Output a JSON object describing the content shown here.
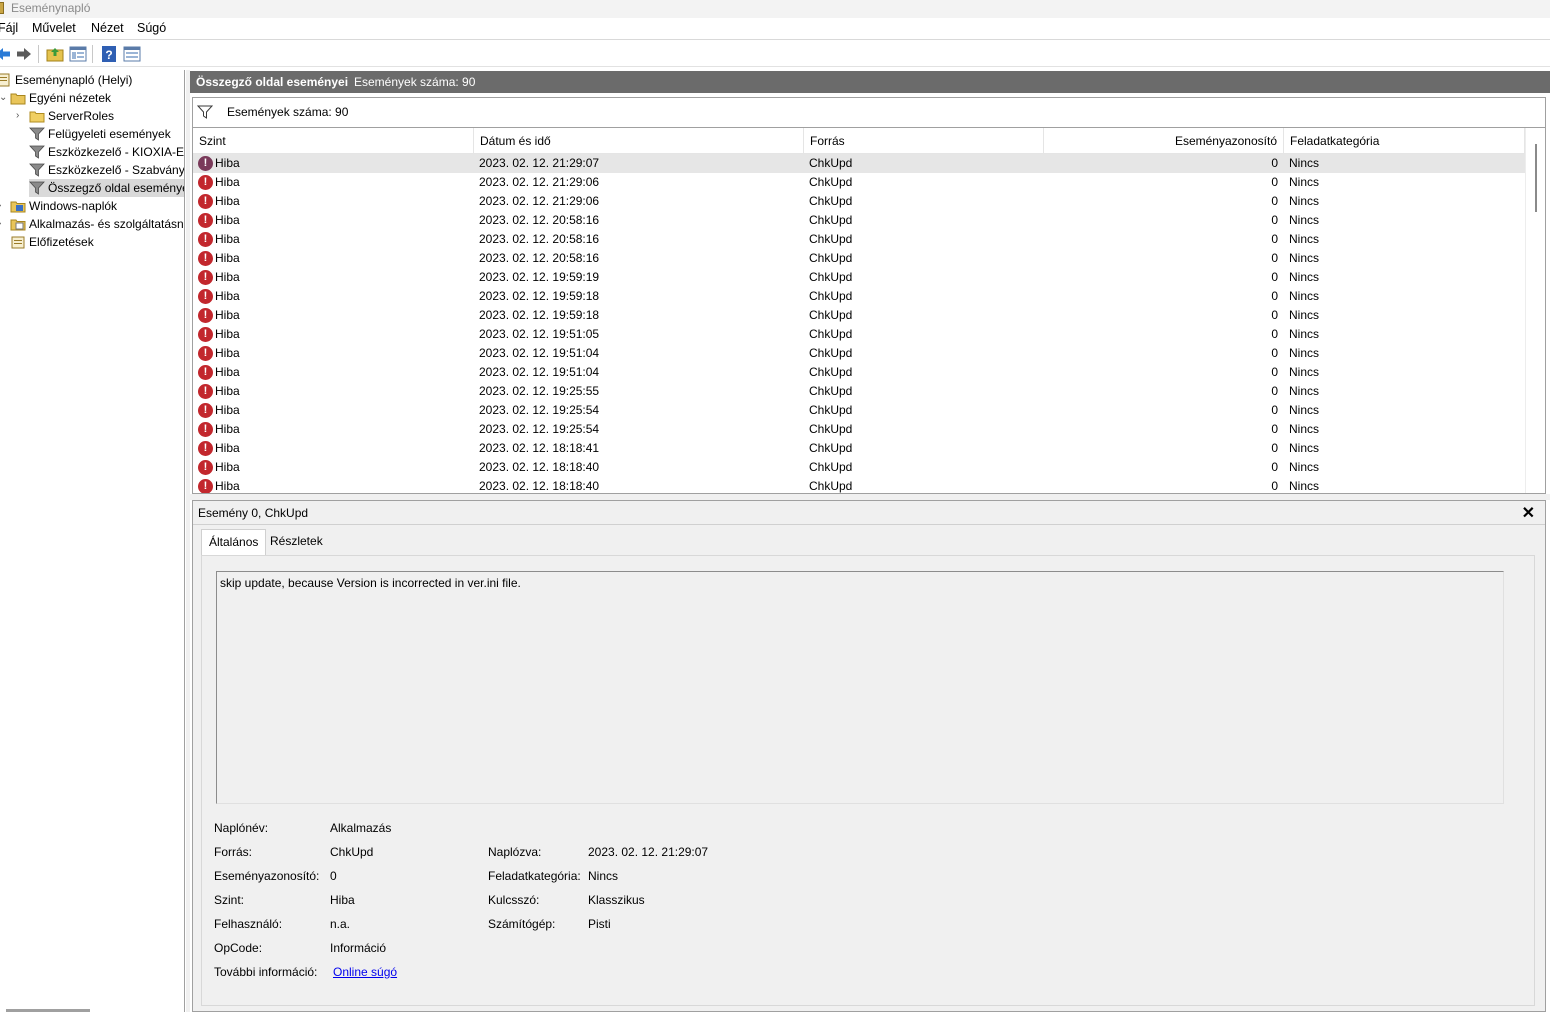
{
  "window": {
    "title": "Eseménynapló"
  },
  "menu": [
    "Fájl",
    "Művelet",
    "Nézet",
    "Súgó"
  ],
  "tree": {
    "root": "Eseménynapló (Helyi)",
    "custom_views": "Egyéni nézetek",
    "server_roles": "ServerRoles",
    "admin_events": "Felügyeleti események",
    "dev_kioxia": "Eszközkezelő - KIOXIA-E",
    "dev_std": "Eszközkezelő - Szabványo",
    "summary": "Összegző oldal eseménye",
    "windows_logs": "Windows-naplók",
    "app_services": "Alkalmazás- és szolgáltatásn",
    "subscriptions": "Előfizetések"
  },
  "main": {
    "title": "Összegző oldal eseményei",
    "count_label": "Események száma: 90",
    "filter_label": "Események száma: 90"
  },
  "grid": {
    "columns": [
      "Szint",
      "Dátum és idő",
      "Forrás",
      "Eseményazonosító",
      "Feladatkategória"
    ],
    "rows": [
      {
        "level": "Hiba",
        "date": "2023. 02. 12. 21:29:07",
        "source": "ChkUpd",
        "id": "0",
        "cat": "Nincs"
      },
      {
        "level": "Hiba",
        "date": "2023. 02. 12. 21:29:06",
        "source": "ChkUpd",
        "id": "0",
        "cat": "Nincs"
      },
      {
        "level": "Hiba",
        "date": "2023. 02. 12. 21:29:06",
        "source": "ChkUpd",
        "id": "0",
        "cat": "Nincs"
      },
      {
        "level": "Hiba",
        "date": "2023. 02. 12. 20:58:16",
        "source": "ChkUpd",
        "id": "0",
        "cat": "Nincs"
      },
      {
        "level": "Hiba",
        "date": "2023. 02. 12. 20:58:16",
        "source": "ChkUpd",
        "id": "0",
        "cat": "Nincs"
      },
      {
        "level": "Hiba",
        "date": "2023. 02. 12. 20:58:16",
        "source": "ChkUpd",
        "id": "0",
        "cat": "Nincs"
      },
      {
        "level": "Hiba",
        "date": "2023. 02. 12. 19:59:19",
        "source": "ChkUpd",
        "id": "0",
        "cat": "Nincs"
      },
      {
        "level": "Hiba",
        "date": "2023. 02. 12. 19:59:18",
        "source": "ChkUpd",
        "id": "0",
        "cat": "Nincs"
      },
      {
        "level": "Hiba",
        "date": "2023. 02. 12. 19:59:18",
        "source": "ChkUpd",
        "id": "0",
        "cat": "Nincs"
      },
      {
        "level": "Hiba",
        "date": "2023. 02. 12. 19:51:05",
        "source": "ChkUpd",
        "id": "0",
        "cat": "Nincs"
      },
      {
        "level": "Hiba",
        "date": "2023. 02. 12. 19:51:04",
        "source": "ChkUpd",
        "id": "0",
        "cat": "Nincs"
      },
      {
        "level": "Hiba",
        "date": "2023. 02. 12. 19:51:04",
        "source": "ChkUpd",
        "id": "0",
        "cat": "Nincs"
      },
      {
        "level": "Hiba",
        "date": "2023. 02. 12. 19:25:55",
        "source": "ChkUpd",
        "id": "0",
        "cat": "Nincs"
      },
      {
        "level": "Hiba",
        "date": "2023. 02. 12. 19:25:54",
        "source": "ChkUpd",
        "id": "0",
        "cat": "Nincs"
      },
      {
        "level": "Hiba",
        "date": "2023. 02. 12. 19:25:54",
        "source": "ChkUpd",
        "id": "0",
        "cat": "Nincs"
      },
      {
        "level": "Hiba",
        "date": "2023. 02. 12. 18:18:41",
        "source": "ChkUpd",
        "id": "0",
        "cat": "Nincs"
      },
      {
        "level": "Hiba",
        "date": "2023. 02. 12. 18:18:40",
        "source": "ChkUpd",
        "id": "0",
        "cat": "Nincs"
      },
      {
        "level": "Hiba",
        "date": "2023. 02. 12. 18:18:40",
        "source": "ChkUpd",
        "id": "0",
        "cat": "Nincs"
      }
    ]
  },
  "detail": {
    "title": "Esemény 0, ChkUpd",
    "tab_general": "Általános",
    "tab_details": "Részletek",
    "message": "skip update, because Version is incorrected in ver.ini file.",
    "props": {
      "log_name_label": "Naplónév:",
      "log_name": "Alkalmazás",
      "source_label": "Forrás:",
      "source": "ChkUpd",
      "logged_label": "Naplózva:",
      "logged": "2023. 02. 12. 21:29:07",
      "event_id_label": "Eseményazonosító:",
      "event_id": "0",
      "task_cat_label": "Feladatkategória:",
      "task_cat": "Nincs",
      "level_label": "Szint:",
      "level": "Hiba",
      "keyword_label": "Kulcsszó:",
      "keyword": "Klasszikus",
      "user_label": "Felhasználó:",
      "user": "n.a.",
      "computer_label": "Számítógép:",
      "computer": "Pisti",
      "opcode_label": "OpCode:",
      "opcode": "Információ",
      "more_info_label": "További információ:",
      "more_info_link": "Online súgó"
    }
  },
  "colors": {
    "header_bg": "#6b6b6b",
    "error_red": "#c2272d",
    "link": "#0000ee"
  }
}
